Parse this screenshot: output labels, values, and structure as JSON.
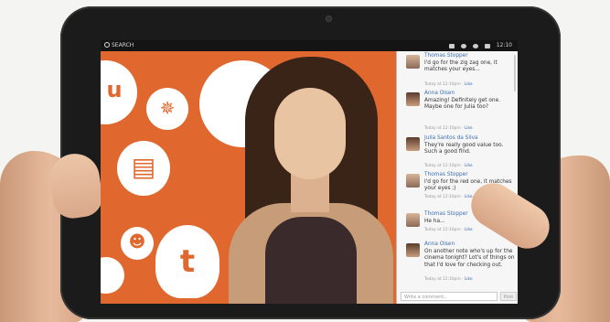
{
  "topbar": {
    "search_label": "SEARCH",
    "time": "12:10"
  },
  "chat": {
    "items": [
      {
        "name": "Thomas Stopper",
        "message": "I'd go for the zig zag one, it matches your eyes...",
        "meta": "Today at 12:10pm · ",
        "like": "Like"
      },
      {
        "name": "Anna Olsen",
        "message": "Amazing! Definitely get one. Maybe one for Julia too?",
        "meta": "Today at 12:10pm · ",
        "like": "Like"
      },
      {
        "name": "Julia Santos da Silva",
        "message": "They're really good value too. Such a good find.",
        "meta": "Today at 12:10pm · ",
        "like": "Like"
      },
      {
        "name": "Thomas Stopper",
        "message": "I'd go for the red one, it matches your eyes ;)",
        "meta": "Today at 12:10pm · ",
        "like": "Like"
      },
      {
        "name": "Thomas Stopper",
        "message": "He ha...",
        "meta": "Today at 12:10pm · ",
        "like": "Like"
      },
      {
        "name": "Anna Olsen",
        "message": "On another note who's up for the cinema tonight? Lot's of things on that I'd love for checking out.",
        "meta": "Today at 12:10pm · ",
        "like": "Like"
      }
    ],
    "comment_placeholder": "Write a comment...",
    "post_label": "Post"
  }
}
